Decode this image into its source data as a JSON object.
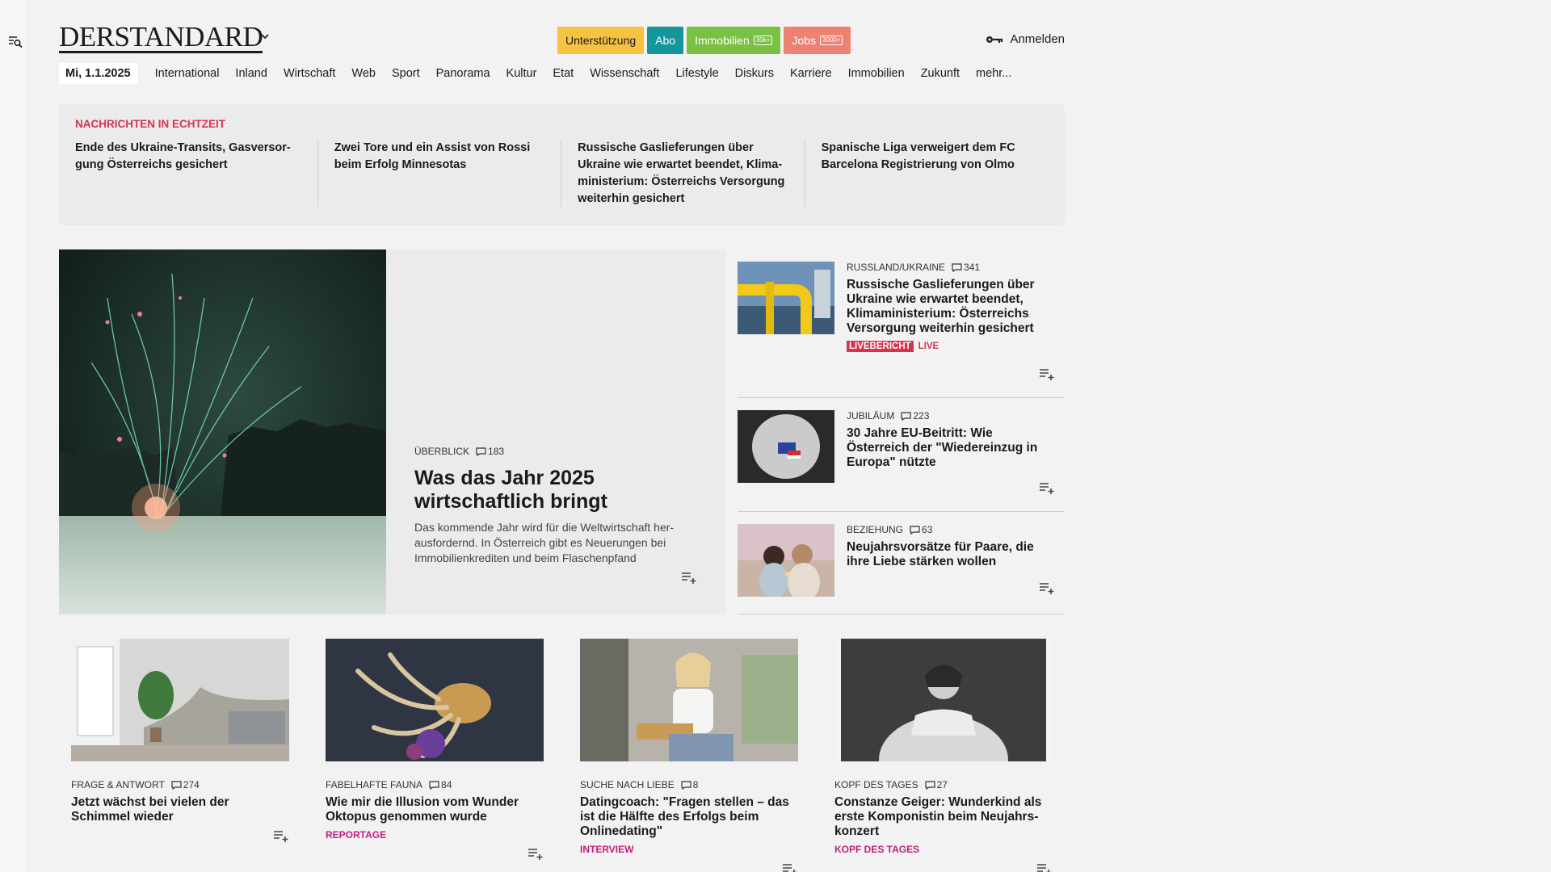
{
  "site": {
    "logo": "DERSTANDARD",
    "login_label": "Anmelden"
  },
  "top_buttons": [
    {
      "label": "Unterstützung"
    },
    {
      "label": "Abo"
    },
    {
      "label": "Immobilien",
      "count": "30k+"
    },
    {
      "label": "Jobs",
      "count": "3000+"
    }
  ],
  "nav": {
    "date": "Mi, 1.1.2025",
    "items": [
      "International",
      "Inland",
      "Wirtschaft",
      "Web",
      "Sport",
      "Panorama",
      "Kultur",
      "Etat",
      "Wissenschaft",
      "Lifestyle",
      "Diskurs",
      "Karriere",
      "Immobilien",
      "Zukunft",
      "mehr..."
    ]
  },
  "ticker": {
    "title": "Nachrichten in Echtzeit",
    "items": [
      "Ende des Ukraine-Transits, Gasversor-gung Österreichs gesichert",
      "Zwei Tore und ein Assist von Rossi beim Erfolg Minnesotas",
      "Russische Gaslieferungen über Ukraine wie erwartet beendet, Klima-ministerium: Österreichs Versorgung weiterhin gesichert",
      "Spanische Liga verweigert dem FC Barcelona Registrierung von Olmo"
    ]
  },
  "hero": {
    "kicker": "Überblick",
    "comments": "183",
    "title": "Was das Jahr 2025 wirtschaftlich bringt",
    "description": "Das kommende Jahr wird für die Weltwirtschaft her-ausfordernd. In Österreich gibt es Neuerungen bei Immobilienkrediten und beim Flaschenpfand"
  },
  "side": [
    {
      "kicker": "Russland/Ukraine",
      "comments": "341",
      "title": "Russische Gaslieferungen über Ukraine wie erwartet beendet, Klimaministerium: Österreichs Versorgung weiterhin gesichert",
      "badge": "Livebericht",
      "badge2": "Live"
    },
    {
      "kicker": "Jubiläum",
      "comments": "223",
      "title": "30 Jahre EU-Beitritt: Wie Österreich der \"Wiedereinzug in Europa\" nützte"
    },
    {
      "kicker": "Beziehung",
      "comments": "63",
      "title": "Neujahrsvorsätze für Paare, die ihre Liebe stärken wollen"
    }
  ],
  "cards": [
    {
      "kicker": "Frage & Antwort",
      "comments": "274",
      "title": "Jetzt wächst bei vielen der Schimmel wieder",
      "tag": ""
    },
    {
      "kicker": "Fabelhafte Fauna",
      "comments": "84",
      "title": "Wie mir die Illusion vom Wunder Oktopus genommen wurde",
      "tag": "Reportage"
    },
    {
      "kicker": "Suche nach Liebe",
      "comments": "8",
      "title": "Datingcoach: \"Fragen stellen – das ist die Hälfte des Erfolgs beim Onlinedating\"",
      "tag": "Interview"
    },
    {
      "kicker": "Kopf des Tages",
      "comments": "27",
      "title": "Constanze Geiger: Wunderkind als erste Komponistin beim Neujahrs-konzert",
      "tag": "Kopf des Tages"
    }
  ],
  "colors": {
    "accent_red": "#d6334e",
    "tag_magenta": "#c21e80",
    "abo_teal": "#14979b",
    "support_yellow": "#f5c242"
  }
}
